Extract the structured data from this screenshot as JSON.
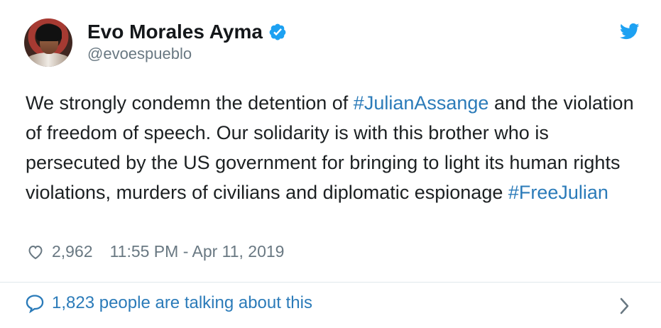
{
  "author": {
    "display_name": "Evo Morales Ayma",
    "handle": "@evoespueblo"
  },
  "tweet": {
    "text_before": "We strongly condemn the detention of ",
    "hashtag_1": "#JulianAssange",
    "text_middle": " and the violation of freedom of speech. Our solidarity is with this brother who is persecuted by the US government for bringing to light its human rights violations, murders of civilians and diplomatic espionage ",
    "hashtag_2": "#FreeJulian"
  },
  "meta": {
    "likes": "2,962",
    "timestamp": "11:55 PM - Apr 11, 2019"
  },
  "footer": {
    "conversation": "1,823 people are talking about this"
  },
  "icons": {
    "verified": "verified-icon",
    "twitter": "twitter-bird-icon",
    "like": "heart-icon",
    "reply": "speech-bubble-icon",
    "chevron": "chevron-right-icon"
  },
  "colors": {
    "accent": "#1da1f2",
    "link": "#2b7bb9",
    "muted": "#697882",
    "text": "#1c2022",
    "border": "#e1e8ed"
  }
}
